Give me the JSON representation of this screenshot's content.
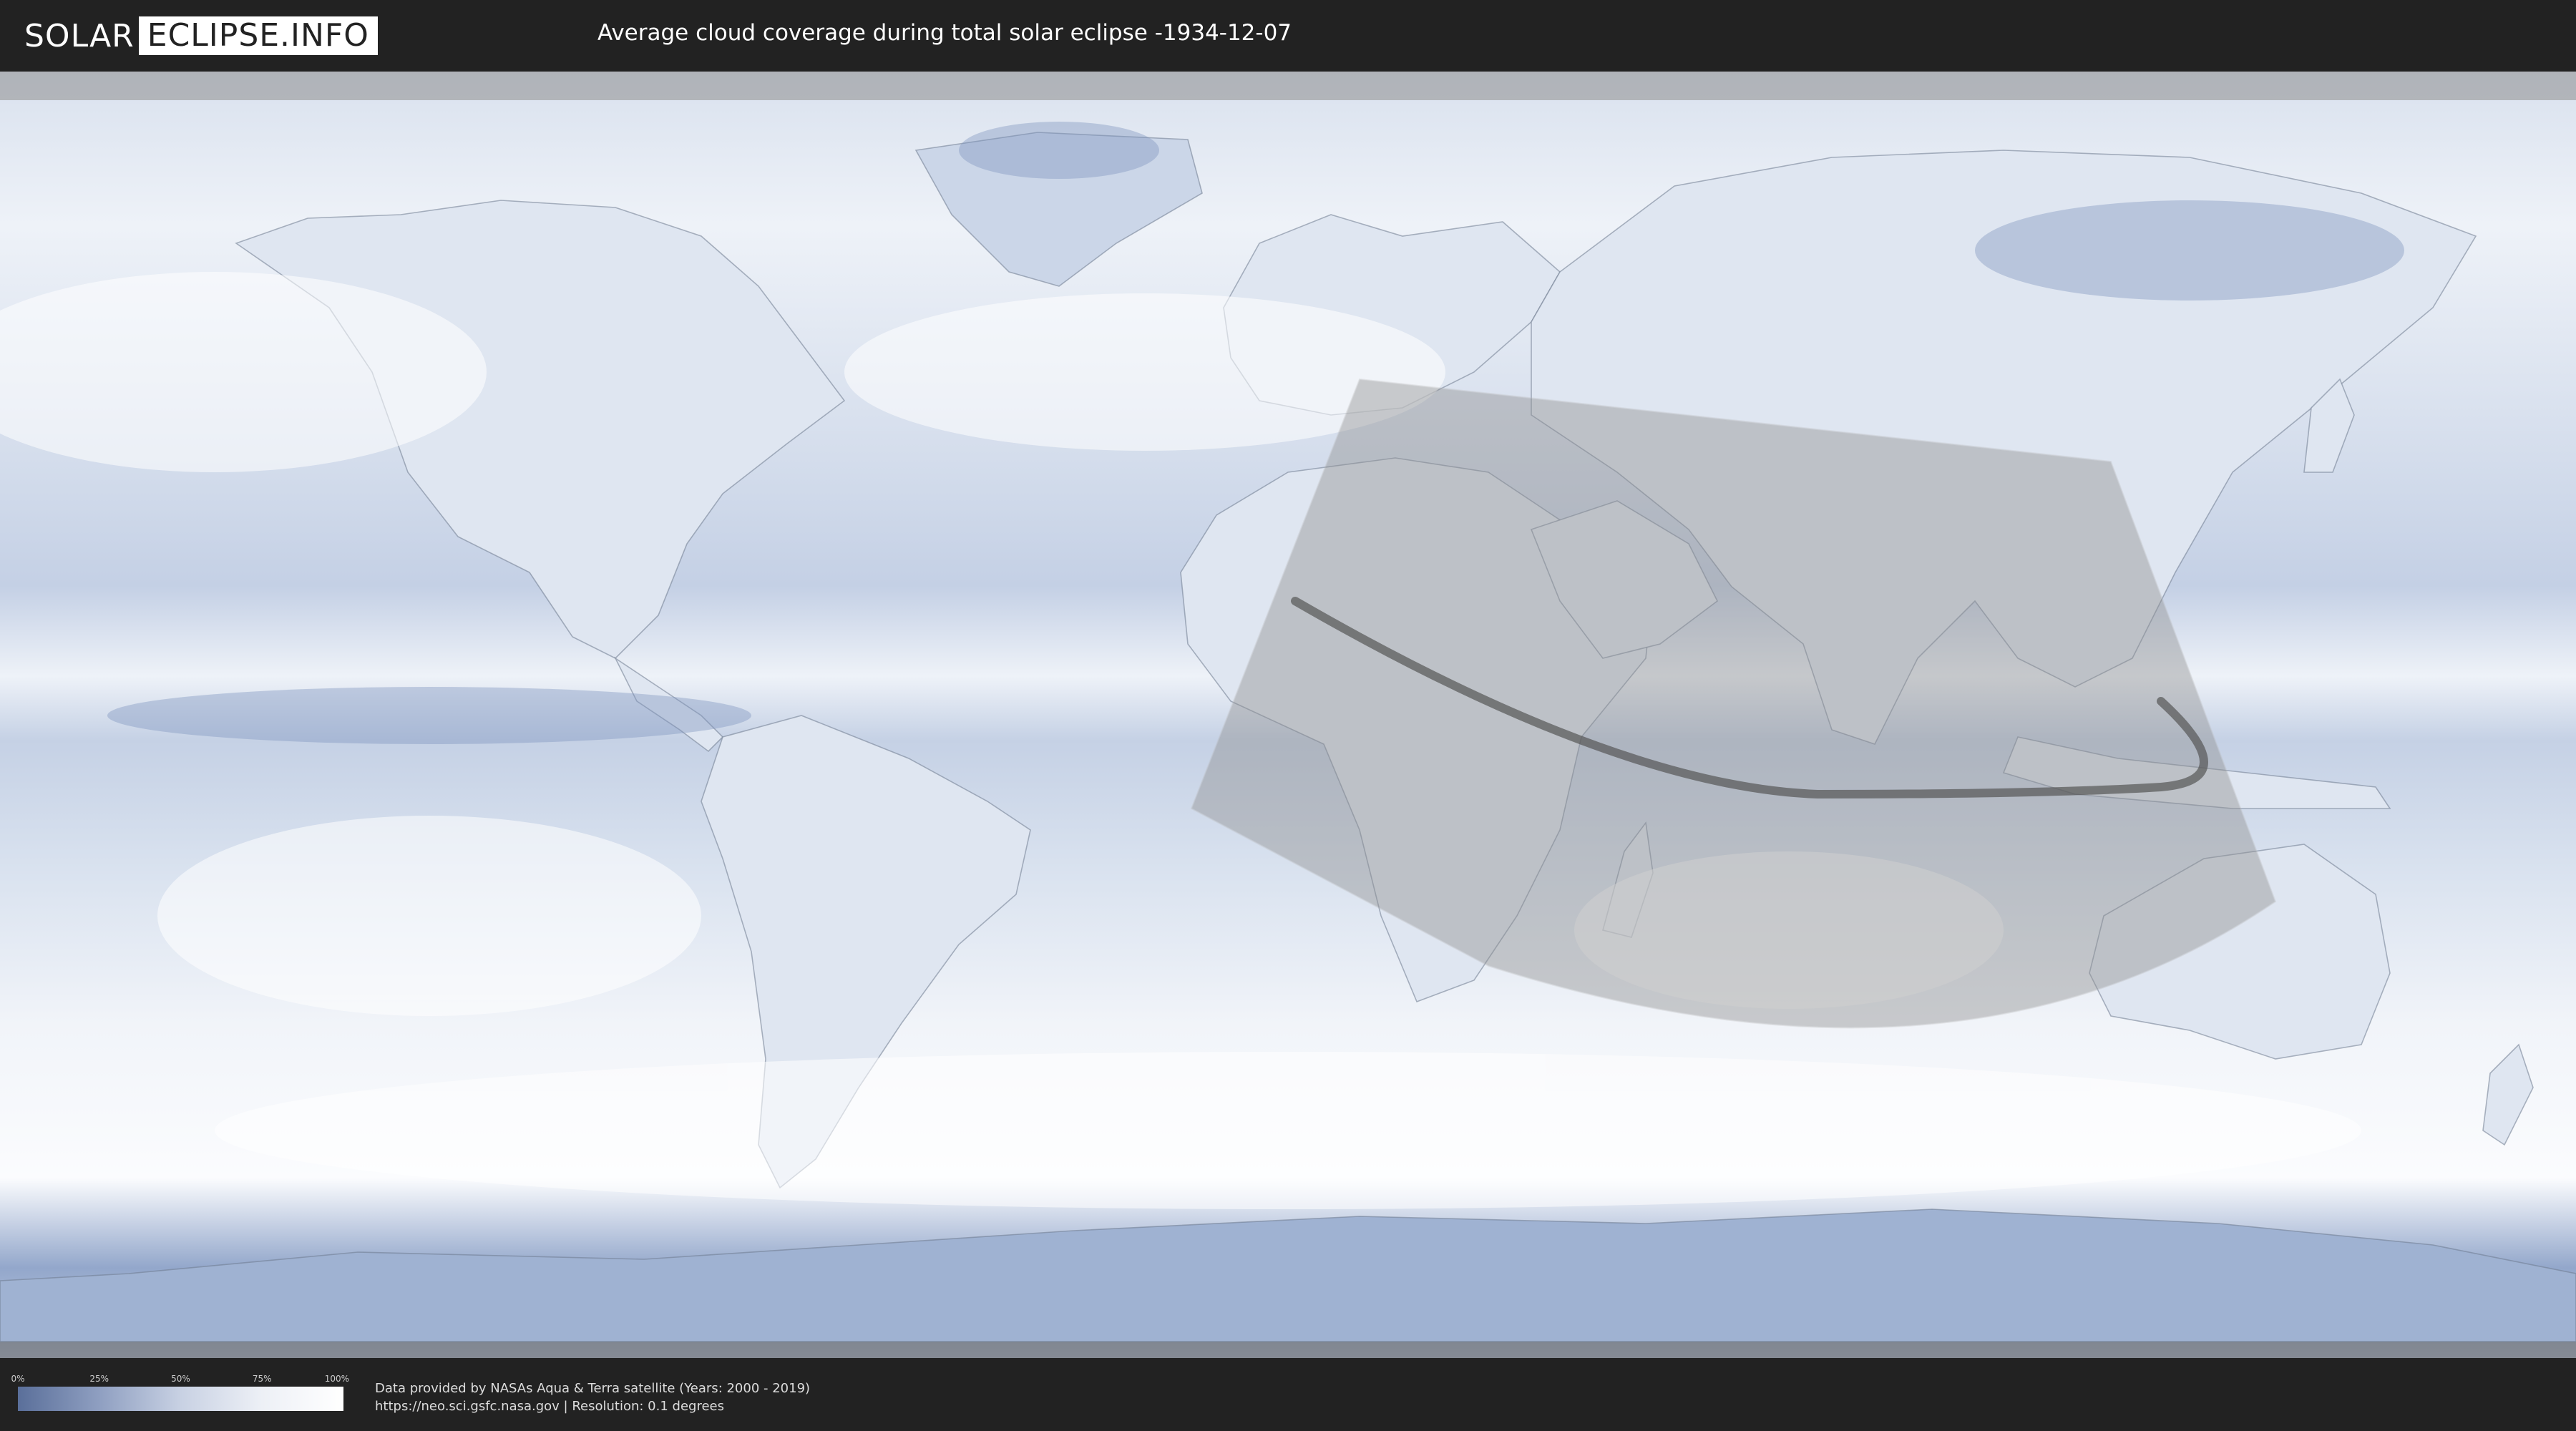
{
  "header": {
    "logo_left": "SOLAR",
    "logo_right": "ECLIPSE.INFO",
    "title": "Average cloud coverage during total solar eclipse -1934-12-07"
  },
  "legend": {
    "ticks": [
      "0%",
      "25%",
      "50%",
      "75%",
      "100%"
    ],
    "colors": {
      "low": "#5a6f9a",
      "high": "#ffffff"
    }
  },
  "credits": {
    "line1": "Data provided by NASAs Aqua & Terra satellite (Years: 2000 - 2019)",
    "line2": "https://neo.sci.gsfc.nasa.gov | Resolution: 0.1 degrees"
  },
  "colors": {
    "ocean_cloud": "#e6edf6",
    "cloud_deep": "#6f87b5",
    "bar": "#222222",
    "path": "#555555"
  }
}
